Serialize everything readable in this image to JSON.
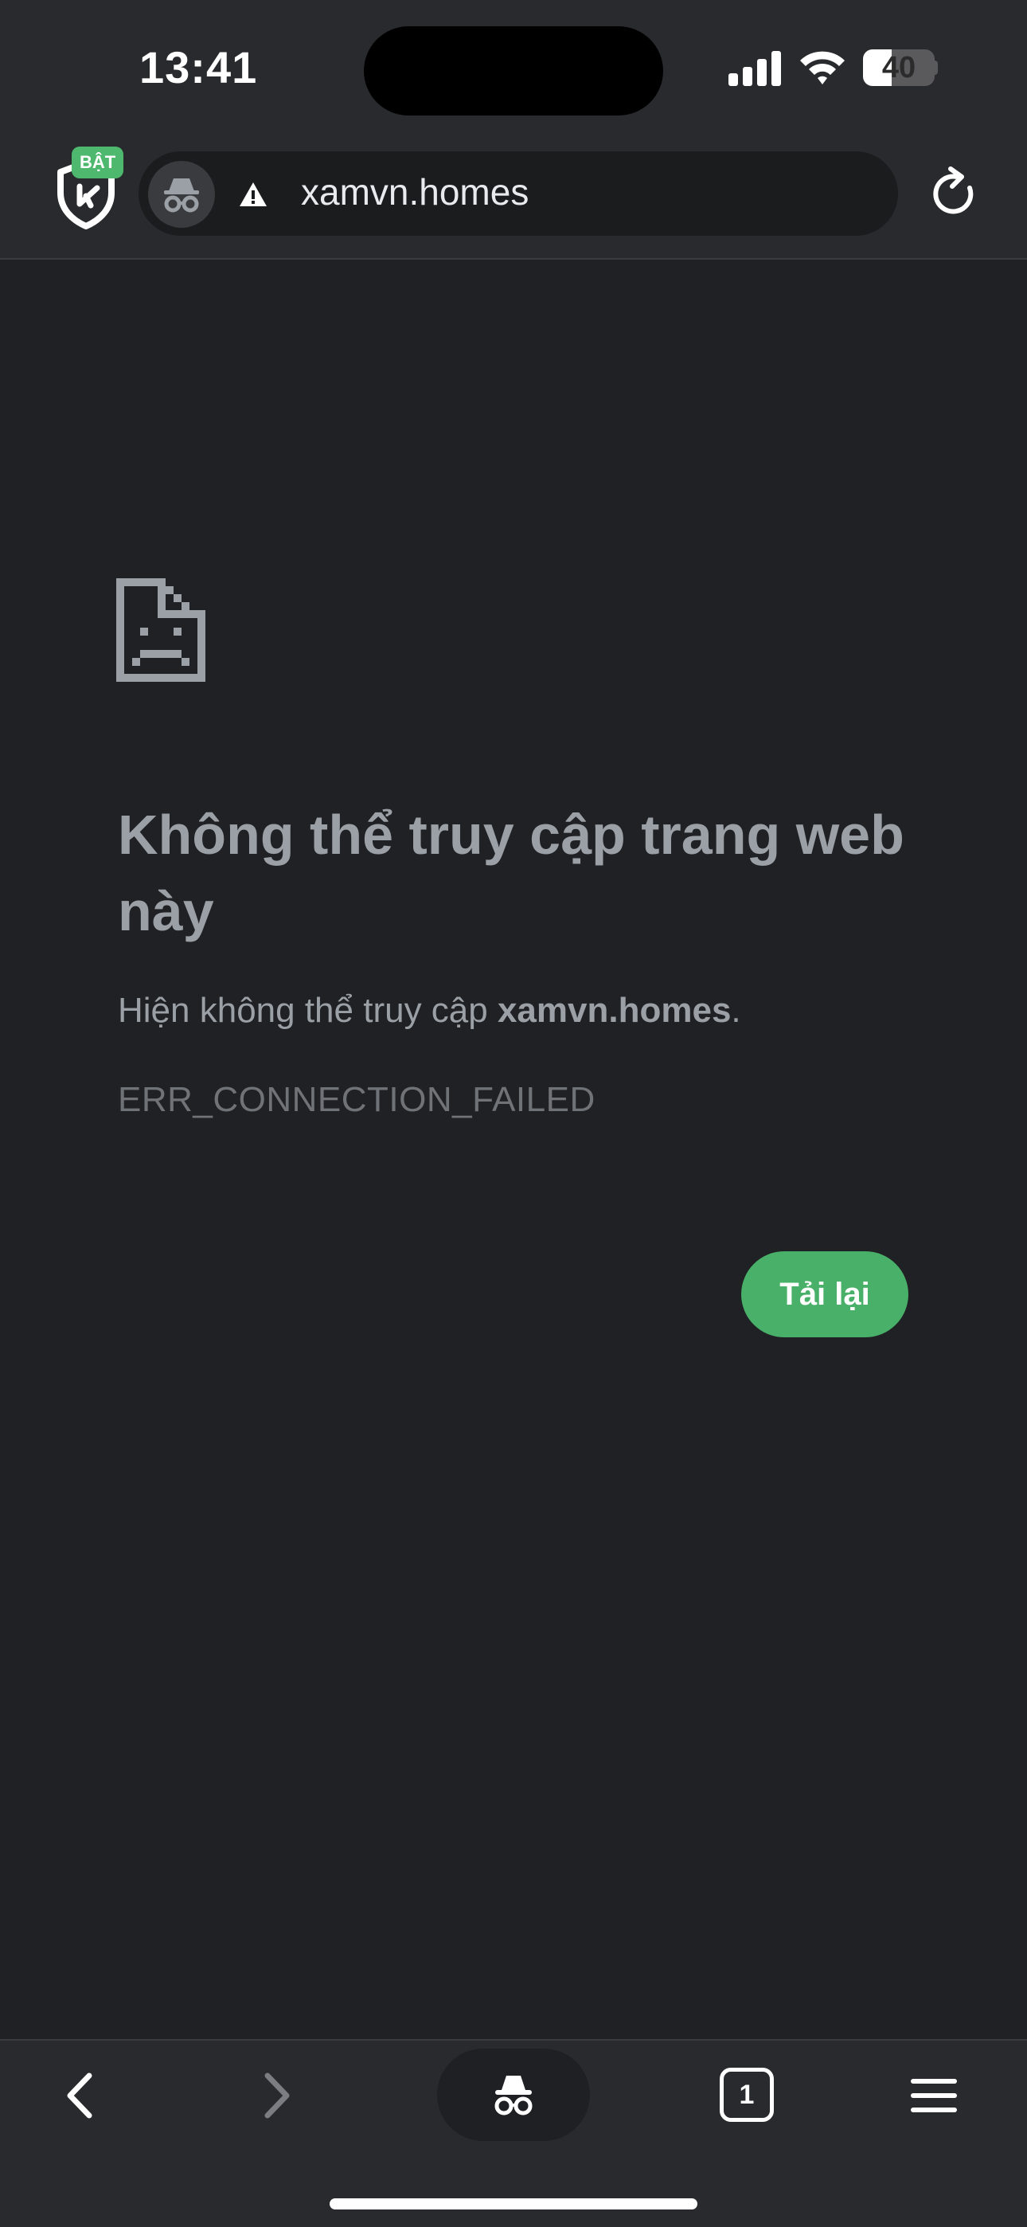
{
  "status_bar": {
    "time": "13:41",
    "battery_level": "40",
    "battery_fraction": 0.4
  },
  "toolbar": {
    "shield_badge": "BẬT",
    "url": "xamvn.homes"
  },
  "error_page": {
    "title": "Không thể truy cập trang web này",
    "description_prefix": "Hiện không thể truy cập ",
    "description_host": "xamvn.homes",
    "description_suffix": ".",
    "error_code": "ERR_CONNECTION_FAILED",
    "reload_label": "Tải lại"
  },
  "bottom_bar": {
    "tab_count": "1"
  },
  "icons": [
    "shield-icon",
    "incognito-icon",
    "warning-icon",
    "reload-icon",
    "sad-document-icon",
    "back-icon",
    "forward-icon",
    "tabs-icon",
    "menu-icon"
  ],
  "colors": {
    "background": "#202124",
    "toolbar": "#292a2d",
    "accent_green": "#48b068",
    "text_muted": "#9aa0a6"
  }
}
